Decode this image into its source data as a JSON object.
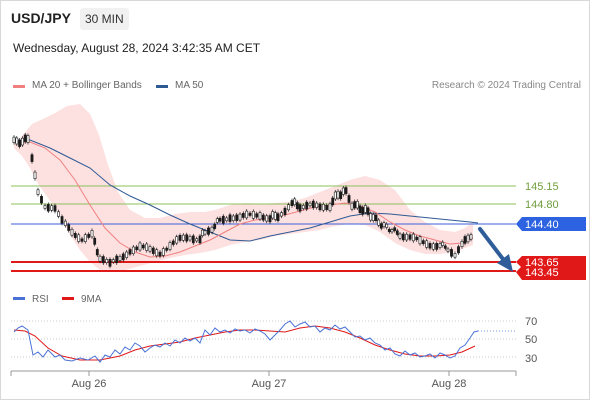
{
  "header": {
    "symbol": "USD/JPY",
    "timeframe": "30 MIN",
    "datetime": "Wednesday, August 28, 2024 3:42:35 AM CET"
  },
  "legend": {
    "ma20_label": "MA 20 + Bollinger Bands",
    "ma50_label": "MA 50",
    "credit": "Research © 2024 Trading Central"
  },
  "colors": {
    "ma20": "#f08080",
    "ma50": "#2e5a94",
    "bollinger_fill": "#fde0e0",
    "resistance": "#8cc05a",
    "pivot": "#3c5fd8",
    "support": "#e01818",
    "rsi": "#4a72d6",
    "rsi_ma": "#e01818",
    "arrow": "#2f5d9a",
    "candle": "#1a1a1a"
  },
  "levels": {
    "resistance": [
      "145.15",
      "144.80"
    ],
    "pivot": "144.40",
    "support": [
      "143.65",
      "143.45"
    ]
  },
  "rsi_panel": {
    "legend_rsi": "RSI",
    "legend_ma": "9MA",
    "ticks": [
      "70",
      "50",
      "30"
    ]
  },
  "x_axis": {
    "labels": [
      "Aug 26",
      "Aug 27",
      "Aug 28"
    ]
  },
  "forecast_icon": "down-arrow-icon"
}
